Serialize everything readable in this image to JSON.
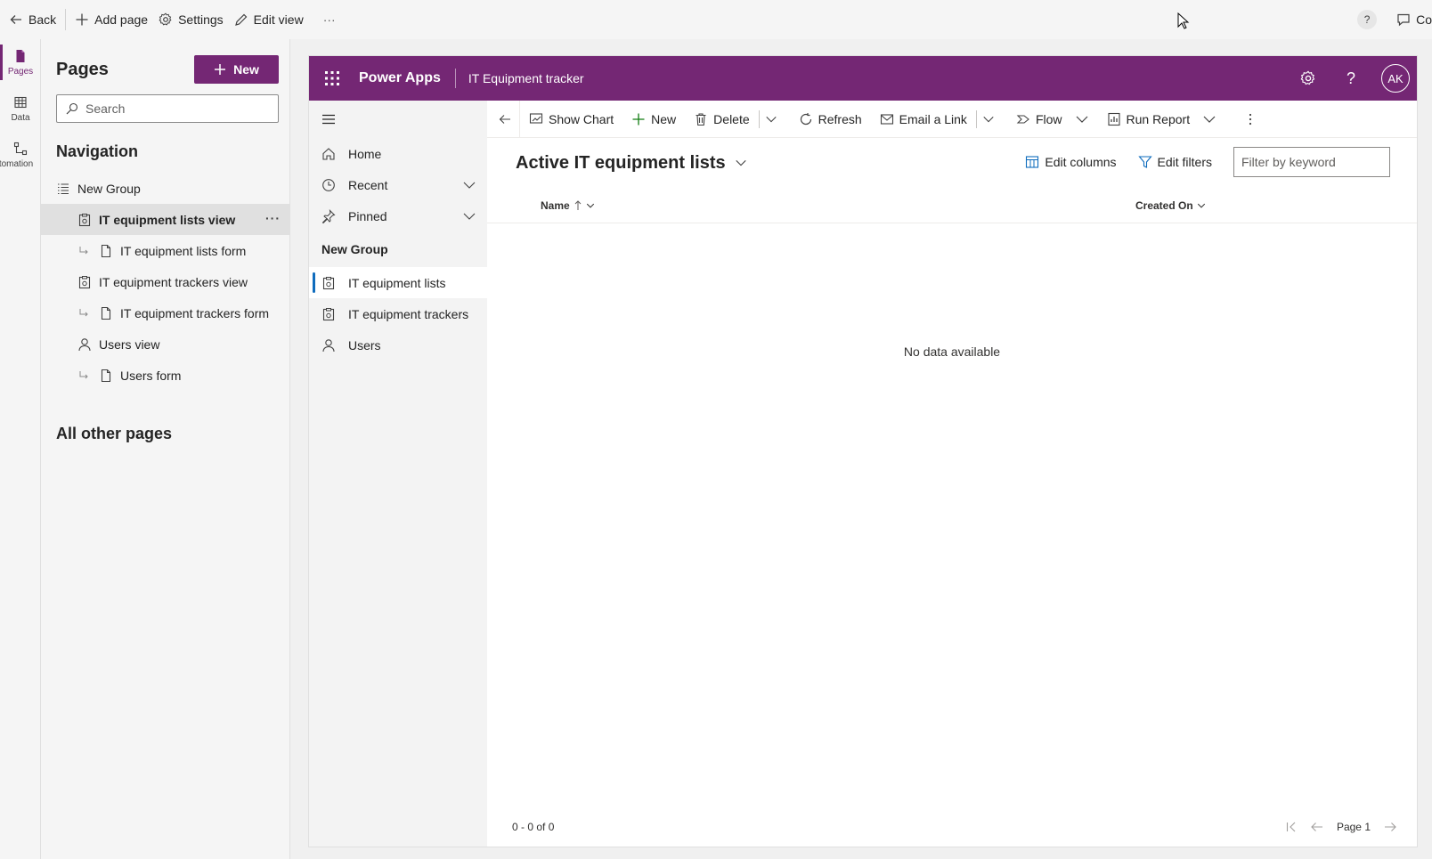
{
  "topbar": {
    "back": "Back",
    "add_page": "Add page",
    "settings": "Settings",
    "edit_view": "Edit view",
    "more": "···",
    "help": "?",
    "comments": "Co"
  },
  "rail": {
    "items": [
      {
        "label": "Pages"
      },
      {
        "label": "Data"
      },
      {
        "label": "tomation"
      }
    ]
  },
  "panel": {
    "title": "Pages",
    "new_label": "New",
    "search_placeholder": "Search",
    "navigation_title": "Navigation",
    "tree": [
      {
        "label": "New Group"
      },
      {
        "label": "IT equipment lists view"
      },
      {
        "label": "IT equipment lists form"
      },
      {
        "label": "IT equipment trackers view"
      },
      {
        "label": "IT equipment trackers form"
      },
      {
        "label": "Users view"
      },
      {
        "label": "Users form"
      }
    ],
    "selected_more": "···",
    "other_title": "All other pages"
  },
  "app": {
    "name": "Power Apps",
    "title": "IT Equipment tracker",
    "avatar": "AK",
    "help": "?",
    "accent": "#742774"
  },
  "sitemap": {
    "items": [
      {
        "label": "Home"
      },
      {
        "label": "Recent"
      },
      {
        "label": "Pinned"
      }
    ],
    "group": "New Group",
    "group_items": [
      {
        "label": "IT equipment lists"
      },
      {
        "label": "IT equipment trackers"
      },
      {
        "label": "Users"
      }
    ]
  },
  "commands": {
    "show_chart": "Show Chart",
    "new": "New",
    "delete": "Delete",
    "refresh": "Refresh",
    "email_link": "Email a Link",
    "flow": "Flow",
    "run_report": "Run Report"
  },
  "view": {
    "title": "Active IT equipment lists",
    "edit_columns": "Edit columns",
    "edit_filters": "Edit filters",
    "filter_placeholder": "Filter by keyword"
  },
  "grid": {
    "columns": [
      {
        "label": "Name"
      },
      {
        "label": "Created On"
      }
    ],
    "empty": "No data available",
    "record_count": "0 - 0 of 0",
    "page": "Page 1"
  }
}
